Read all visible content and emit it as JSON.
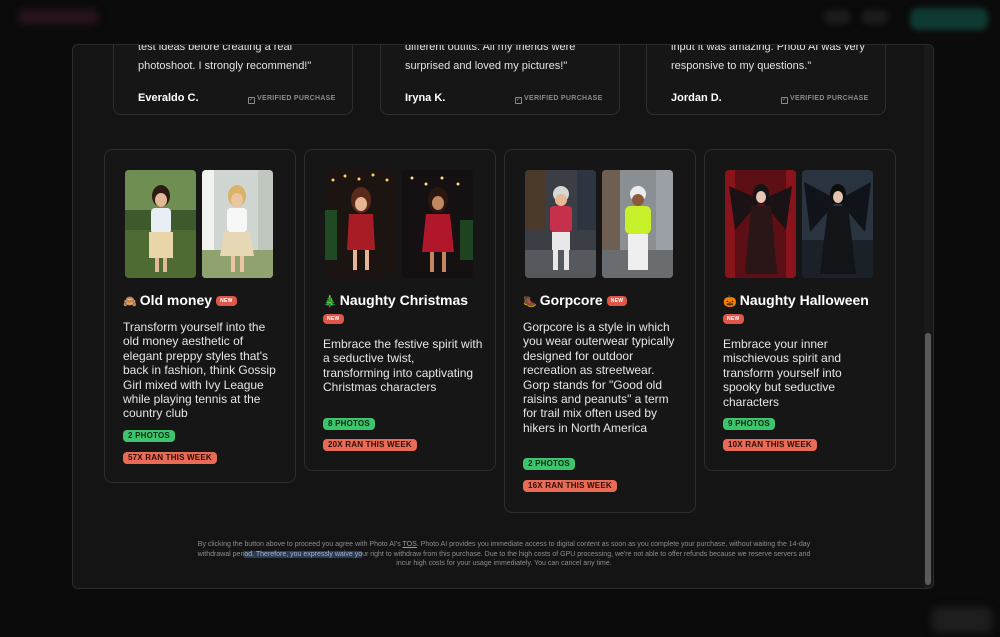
{
  "reviews": [
    {
      "text_lines": [
        "test ideas before creating a real",
        "photoshoot. I strongly recommend!\""
      ],
      "author": "Everaldo C.",
      "verified": "VERIFIED PURCHASE"
    },
    {
      "text_lines": [
        "different outfits. All my friends were",
        "surprised and loved my pictures!\""
      ],
      "author": "Iryna K.",
      "verified": "VERIFIED PURCHASE"
    },
    {
      "text_lines": [
        "input it was amazing. Photo AI was very",
        "responsive to my questions.\""
      ],
      "author": "Jordan D.",
      "verified": "VERIFIED PURCHASE"
    }
  ],
  "packs": [
    {
      "emoji": "🙈",
      "title": "Old money",
      "badge": "NEW",
      "description": "Transform yourself into the old money aesthetic of elegant preppy styles that's back in fashion, think Gossip Girl mixed with Ivy League while playing tennis at the country club",
      "photos": "2 PHOTOS",
      "ran": "57X RAN THIS WEEK"
    },
    {
      "emoji": "🎄",
      "title": "Naughty Christmas",
      "badge": "NEW",
      "description": "Embrace the festive spirit with a seductive twist, transforming into captivating Christmas characters",
      "photos": "8 PHOTOS",
      "ran": "20X RAN THIS WEEK"
    },
    {
      "emoji": "🥾",
      "title": "Gorpcore",
      "badge": "NEW",
      "description": "Gorpcore is a style in which you wear outerwear typically designed for outdoor recreation as streetwear. Gorp stands for \"Good old raisins and peanuts\" a term for trail mix often used by hikers in North America",
      "photos": "2 PHOTOS",
      "ran": "16X RAN THIS WEEK"
    },
    {
      "emoji": "🎃",
      "title": "Naughty Halloween",
      "badge": "NEW",
      "description": "Embrace your inner mischievous spirit and transform yourself into spooky but seductive characters",
      "photos": "9 PHOTOS",
      "ran": "10X RAN THIS WEEK"
    }
  ],
  "disclaimer": {
    "part1": "By clicking the button above to proceed you agree with Photo AI's ",
    "tos": "TOS",
    "part2": ". Photo AI provides you immediate access to digital content as soon as you complete your purchase, without waiting the 14-day withdrawal peri",
    "highlight": "od. Therefore, you expressly waive yo",
    "part3": "ur right to withdraw from this purchase. Due to the high costs of GPU processing, we're not able to offer refunds because we reserve servers and incur high costs for your usage immediately. You can cancel any time."
  },
  "colors": {
    "new_badge": "#e0574a",
    "photos_tag": "#3ec46d",
    "ran_tag": "#e96a55",
    "card_bg": "#161616"
  }
}
